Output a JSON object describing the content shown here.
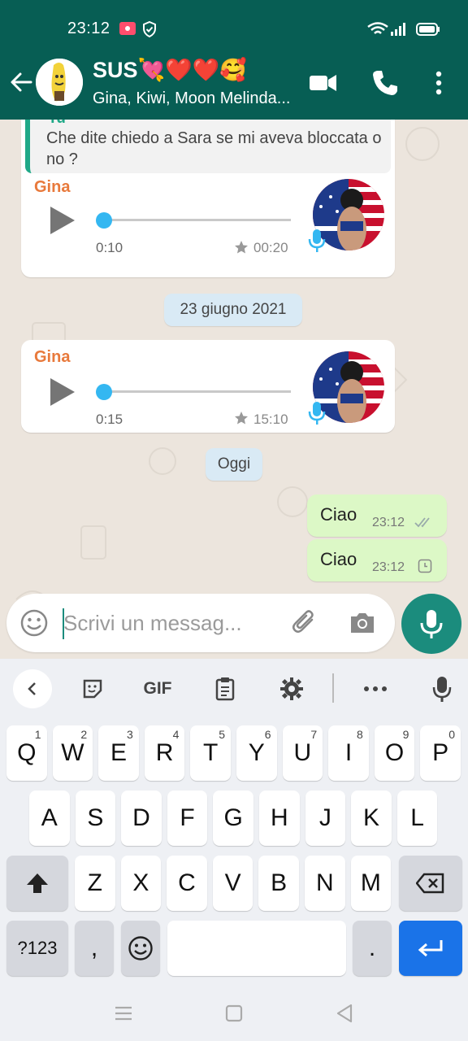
{
  "status_bar": {
    "time": "23:12"
  },
  "header": {
    "group_name": "SUS💘❤️❤️🥰",
    "members": "Gina, Kiwi, Moon Melinda..."
  },
  "messages": {
    "quote_author": "Tu",
    "quote_text": "Che dite chiedo a Sara se mi aveva bloccata o no ?",
    "voice1": {
      "sender": "Gina",
      "duration": "0:10",
      "time": "00:20",
      "starred": true
    },
    "date_chip_1": "23 giugno 2021",
    "voice2": {
      "sender": "Gina",
      "duration": "0:15",
      "time": "15:10",
      "starred": true
    },
    "date_chip_2": "Oggi",
    "out1": {
      "text": "Ciao",
      "time": "23:12",
      "status": "read"
    },
    "out2": {
      "text": "Ciao",
      "time": "23:12",
      "status": "pending"
    }
  },
  "composer": {
    "placeholder": "Scrivi un messag..."
  },
  "keyboard": {
    "toolbar": [
      "<",
      "sticker",
      "GIF",
      "clipboard",
      "settings",
      "•••",
      "mic"
    ],
    "row1": [
      {
        "k": "Q",
        "n": "1"
      },
      {
        "k": "W",
        "n": "2"
      },
      {
        "k": "E",
        "n": "3"
      },
      {
        "k": "R",
        "n": "4"
      },
      {
        "k": "T",
        "n": "5"
      },
      {
        "k": "Y",
        "n": "6"
      },
      {
        "k": "U",
        "n": "7"
      },
      {
        "k": "I",
        "n": "8"
      },
      {
        "k": "O",
        "n": "9"
      },
      {
        "k": "P",
        "n": "0"
      }
    ],
    "row2": [
      "A",
      "S",
      "D",
      "F",
      "G",
      "H",
      "J",
      "K",
      "L"
    ],
    "row3": [
      "Z",
      "X",
      "C",
      "V",
      "B",
      "N",
      "M"
    ],
    "row4": {
      "sym": "?123",
      "comma": ",",
      "period": "."
    },
    "gif_label": "GIF"
  },
  "colors": {
    "header": "#075e54",
    "accent": "#1b8c7d",
    "bubble_out": "#dcf8c6",
    "sender": "#e8793b",
    "voice_knob": "#34b7f1"
  }
}
